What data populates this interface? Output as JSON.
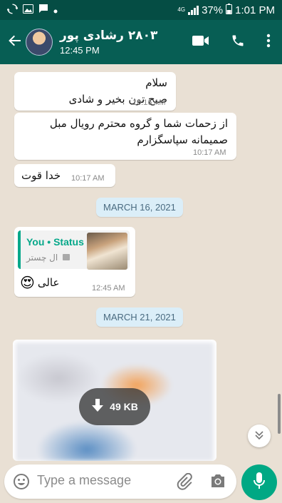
{
  "status_bar": {
    "network": "4G",
    "battery": "37%",
    "time": "1:01 PM"
  },
  "header": {
    "contact_name": "۲۸۰۳ رشادی پور",
    "last_seen": "12:45 PM"
  },
  "messages": [
    {
      "lines": [
        "سلام",
        "صبح تون بخیر و شادی"
      ],
      "time": "10:16 AM"
    },
    {
      "lines": [
        "از زحمات شما و گروه محترم رویال مبل",
        "صمیمانه سپاسگزارم"
      ],
      "time": "10:17 AM"
    },
    {
      "lines": [
        "خدا قوت"
      ],
      "time": "10:17 AM"
    }
  ],
  "dates": [
    "MARCH 16, 2021",
    "MARCH 21, 2021"
  ],
  "status_reply": {
    "quote_title": "You • Status",
    "quote_subtitle": "ال چستر",
    "text": "عالی",
    "emoji": "😍",
    "time": "12:45 AM"
  },
  "media": {
    "size": "49 KB"
  },
  "composer": {
    "placeholder": "Type a message"
  },
  "colors": {
    "header": "#075e54",
    "status_bar": "#054d44",
    "accent": "#00a884",
    "chat_bg": "#e9e0d4",
    "date_chip": "#dbeef8"
  }
}
